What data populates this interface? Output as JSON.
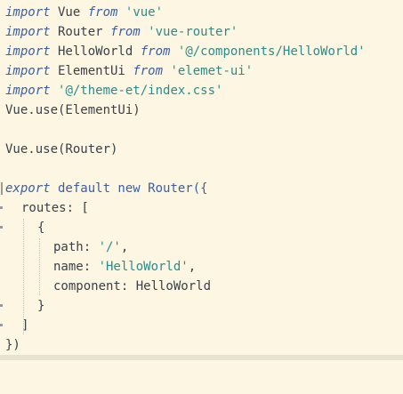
{
  "editor": {
    "lines": [
      {
        "kw": "import",
        "a": " Vue ",
        "kw2": "from",
        "b": " ",
        "str": "'vue'"
      },
      {
        "kw": "import",
        "a": " Router ",
        "kw2": "from",
        "b": " ",
        "str": "'vue-router'"
      },
      {
        "kw": "import",
        "a": " HelloWorld ",
        "kw2": "from",
        "b": " ",
        "str": "'@/components/HelloWorld'"
      },
      {
        "kw": "import",
        "a": " ElementUi ",
        "kw2": "from",
        "b": " ",
        "str": "'elemet-ui'"
      },
      {
        "kw": "import",
        "a": " ",
        "str": "'@/theme-et/index.css'"
      },
      {
        "plain": "Vue.use(ElementUi)"
      },
      {
        "plain": ""
      },
      {
        "plain": "Vue.use(Router)"
      },
      {
        "plain": ""
      },
      {
        "kw": "export",
        "plain": " default new Router({"
      },
      {
        "plain": "routes: ["
      },
      {
        "plain": "{"
      },
      {
        "a": "path: ",
        "str": "'/'",
        "b": ","
      },
      {
        "a": "name: ",
        "str": "'HelloWorld'",
        "b": ","
      },
      {
        "plain": "component: HelloWorld"
      },
      {
        "plain": "}"
      },
      {
        "plain": "]"
      },
      {
        "plain": "})"
      }
    ]
  }
}
